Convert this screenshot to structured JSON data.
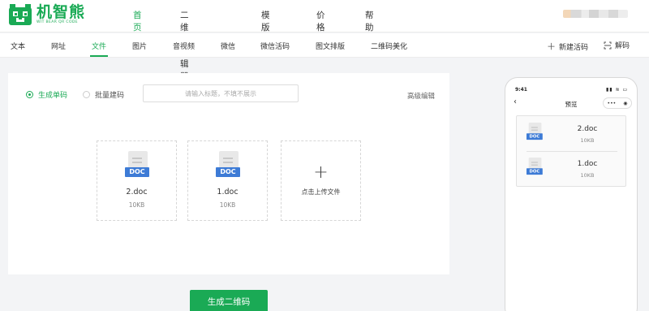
{
  "brand": {
    "name": "机智熊",
    "tagline": "WIT BEAR QR CODE",
    "accent_color": "#1aaa55"
  },
  "top_nav": {
    "items": [
      {
        "label": "首页",
        "active": true
      },
      {
        "label": "二维码编辑器",
        "active": false
      },
      {
        "label": "模版库",
        "active": false
      },
      {
        "label": "价格",
        "active": false
      },
      {
        "label": "帮助",
        "active": false
      }
    ]
  },
  "sub_nav": {
    "tabs": [
      {
        "label": "文本",
        "active": false
      },
      {
        "label": "网址",
        "active": false
      },
      {
        "label": "文件",
        "active": true
      },
      {
        "label": "图片",
        "active": false
      },
      {
        "label": "音视频",
        "active": false
      },
      {
        "label": "微信",
        "active": false
      },
      {
        "label": "微信活码",
        "active": false
      },
      {
        "label": "图文排版",
        "active": false
      },
      {
        "label": "二维码美化",
        "active": false
      }
    ],
    "actions": {
      "new_dynamic": {
        "icon": "plus-icon",
        "label": "新建活码"
      },
      "decode": {
        "icon": "scan-icon",
        "label": "解码"
      }
    }
  },
  "editor": {
    "mode_single": "生成单码",
    "mode_batch": "批量建码",
    "selected_mode": "生成单码",
    "title_input": {
      "value": "",
      "placeholder": "请输入标题，不填不展示"
    },
    "advanced_label": "高级编辑",
    "files": [
      {
        "name": "2.doc",
        "size": "10KB",
        "type_badge": "DOC"
      },
      {
        "name": "1.doc",
        "size": "10KB",
        "type_badge": "DOC"
      }
    ],
    "upload_label": "点击上传文件",
    "generate_button": "生成二维码"
  },
  "preview": {
    "time": "9:41",
    "status_icons": "signal-wifi-battery",
    "title": "预览",
    "capsule_more": "•••",
    "capsule_close": "◉",
    "files": [
      {
        "name": "2.doc",
        "size": "10KB",
        "type_badge": "DOC"
      },
      {
        "name": "1.doc",
        "size": "10KB",
        "type_badge": "DOC"
      }
    ]
  }
}
